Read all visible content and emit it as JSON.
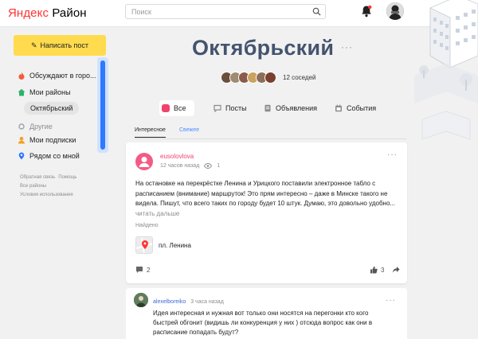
{
  "header": {
    "logo_brand": "Яндекс",
    "logo_product": "Район",
    "search_placeholder": "Поиск",
    "icons": [
      "search-icon",
      "bell-icon",
      "user-avatar"
    ]
  },
  "sidebar": {
    "write_button": "Написать пост",
    "items": [
      {
        "label": "Обсуждают в горо...",
        "icon": "fire-icon"
      },
      {
        "label": "Мои районы",
        "icon": "home-icon"
      },
      {
        "label": "Октябрьский",
        "selected": true
      },
      {
        "label": "Другие",
        "icon": "dot-icon",
        "muted": true
      },
      {
        "label": "Мои подписки",
        "icon": "user-icon"
      },
      {
        "label": "Рядом со мной",
        "icon": "location-icon"
      }
    ],
    "footer_links": [
      "Обратная связь",
      "Помощь",
      "Все районы",
      "Условия использования"
    ]
  },
  "district": {
    "title": "Октябрьский",
    "neighbors_count": "12 соседей",
    "neighbor_colors": [
      "#6b4f3a",
      "#a08a72",
      "#8a5a4c",
      "#c9a35f",
      "#8c6e5a",
      "#7a3f2f"
    ]
  },
  "tabs": [
    {
      "label": "Все",
      "active": true
    },
    {
      "label": "Посты"
    },
    {
      "label": "Объявления"
    },
    {
      "label": "События"
    }
  ],
  "subtabs": {
    "interesting": "Интересное",
    "new": "Свежее"
  },
  "post": {
    "author": "eusolovlova",
    "time": "12 часов назад",
    "views": "1",
    "text": "На остановке на перекрёстке Ленина и Урицкого поставили электронное табло с расписанием (внимание) маршруток! Это прям интересно – даже в Минске такого не видела. Пишут, что всего таких по городу будет 10 штук. Думаю, это довольно удобно...",
    "read_more": "читать дальше",
    "found_label": "Найдено",
    "place": "пл. Ленина",
    "comments": "2",
    "likes": "3"
  },
  "comment": {
    "author": "alexelboreiko",
    "time": "3 часа назад",
    "text": "Идея интересная и нужная вот только они носятся на перегонки кто кого быстрей обгонит (видишь ли конкуренция у них ) отсюда вопрос как они в расписание попадать будут?"
  },
  "colors": {
    "accent_yellow": "#ffdb4d",
    "accent_pink": "#f1436b",
    "title": "#44546f",
    "link_blue": "#4d8dff"
  }
}
